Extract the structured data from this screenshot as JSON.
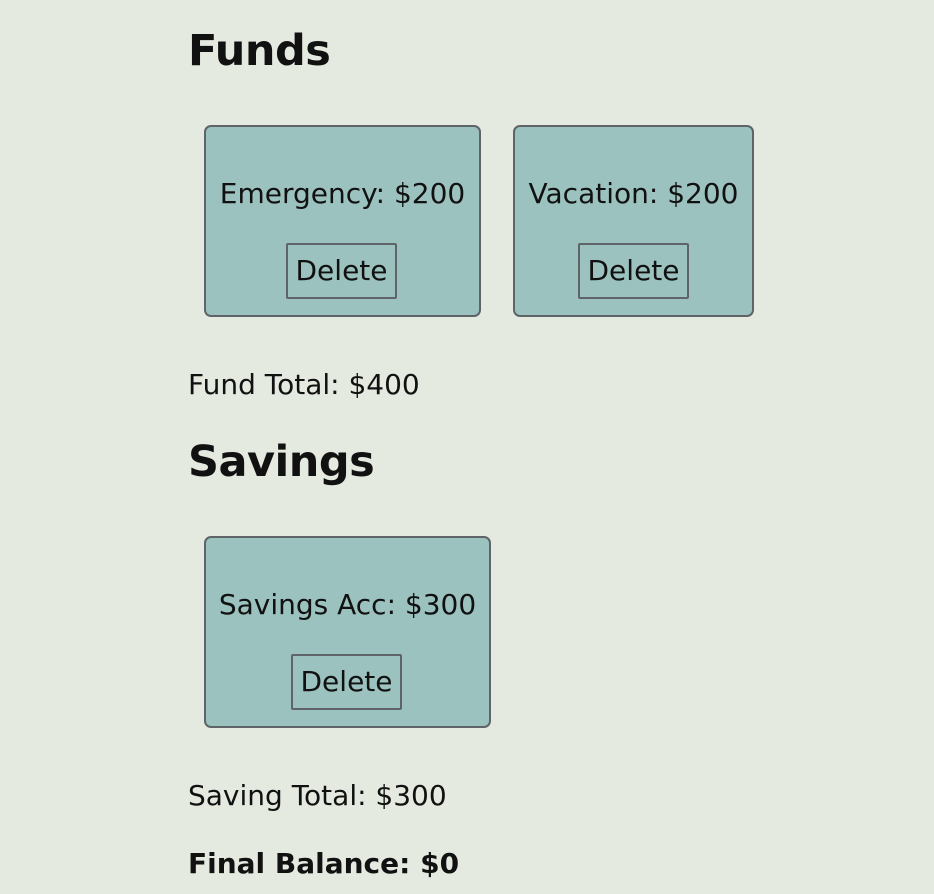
{
  "funds": {
    "title": "Funds",
    "items": [
      {
        "label": "Emergency: $200",
        "delete_label": "Delete"
      },
      {
        "label": "Vacation: $200",
        "delete_label": "Delete"
      }
    ],
    "total": "Fund Total: $400"
  },
  "savings": {
    "title": "Savings",
    "items": [
      {
        "label": "Savings Acc: $300",
        "delete_label": "Delete"
      }
    ],
    "total": "Saving Total: $300"
  },
  "final_balance": "Final Balance: $0",
  "colors": {
    "background": "#e5eae0",
    "card": "#9bc2bf",
    "border": "#5f6468",
    "text": "#111111"
  }
}
